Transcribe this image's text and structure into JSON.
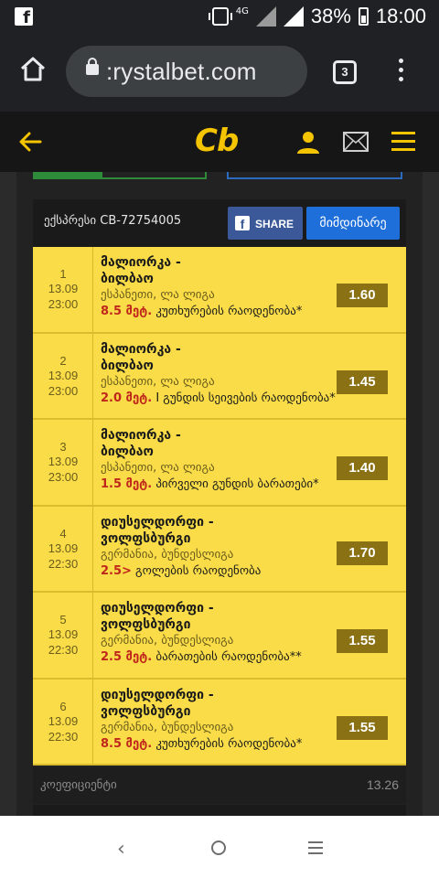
{
  "status_bar": {
    "network": "4G",
    "battery": "38%",
    "time": "18:00"
  },
  "browser": {
    "url": ":rystalbet.com",
    "tab_count": "3"
  },
  "site": {
    "logo": "Cb"
  },
  "ticket": {
    "label": "ექსპრესი  CB-72754005",
    "share_label": "SHARE",
    "status_label": "მიმდინარე"
  },
  "bets": [
    {
      "num": "1",
      "date": "13.09",
      "time": "23:00",
      "match": "მალიორკა - ბილბაო",
      "league": "ესპანეთი, ლა ლიგა",
      "line": "8.5 მეტ.",
      "market": " კუთხურების რაოდენობა*",
      "odds": "1.60"
    },
    {
      "num": "2",
      "date": "13.09",
      "time": "23:00",
      "match": "მალიორკა - ბილბაო",
      "league": "ესპანეთი, ლა ლიგა",
      "line": "2.0 მეტ.",
      "market": " I გუნდის სეივების რაოდენობა*",
      "odds": "1.45"
    },
    {
      "num": "3",
      "date": "13.09",
      "time": "23:00",
      "match": "მალიორკა - ბილბაო",
      "league": "ესპანეთი, ლა ლიგა",
      "line": "1.5 მეტ.",
      "market": " პირველი გუნდის ბარათები*",
      "odds": "1.40"
    },
    {
      "num": "4",
      "date": "13.09",
      "time": "22:30",
      "match": "დიუსელდორფი - ვოლფსბურგი",
      "league": "გერმანია, ბუნდესლიგა",
      "line": "2.5>",
      "market": " გოლების რაოდენობა",
      "odds": "1.70"
    },
    {
      "num": "5",
      "date": "13.09",
      "time": "22:30",
      "match": "დიუსელდორფი - ვოლფსბურგი",
      "league": "გერმანია, ბუნდესლიგა",
      "line": "2.5 მეტ.",
      "market": " ბარათების რაოდენობა**",
      "odds": "1.55"
    },
    {
      "num": "6",
      "date": "13.09",
      "time": "22:30",
      "match": "დიუსელდორფი - ვოლფსბურგი",
      "league": "გერმანია, ბუნდესლიგა",
      "line": "8.5 მეტ.",
      "market": " კუთხურების რაოდენობა*",
      "odds": "1.55"
    }
  ],
  "total": {
    "label": "კოეფიციენტი",
    "value": "13.26"
  },
  "icons": {
    "status": [
      "facebook-notification-icon",
      "vibrate-icon",
      "signal-icon",
      "wifi-icon",
      "battery-icon"
    ],
    "browser": [
      "home-icon",
      "lock-icon",
      "tabs-icon",
      "overflow-menu-icon"
    ],
    "site": [
      "back-arrow-icon",
      "user-icon",
      "mail-icon",
      "hamburger-menu-icon"
    ],
    "nav": [
      "nav-back-icon",
      "nav-home-icon",
      "nav-recents-icon"
    ]
  },
  "colors": {
    "accent_yellow": "#f5c400",
    "bet_bg": "#f9dc47",
    "odds_bg": "#8a7113",
    "facebook": "#3b5998",
    "status_blue": "#1e6fd9",
    "line_red": "#c0261c"
  }
}
